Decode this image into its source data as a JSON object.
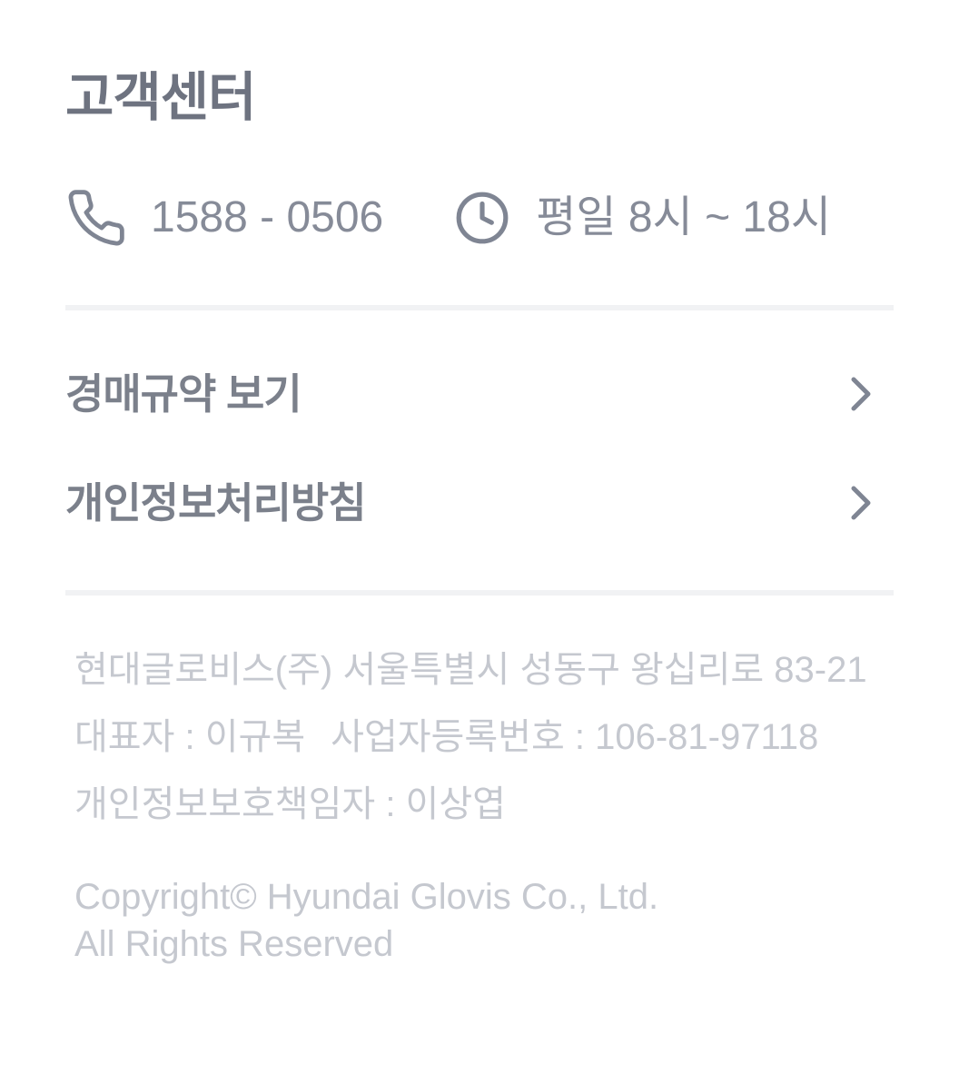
{
  "customer_center": {
    "title": "고객센터",
    "phone_icon": "phone-icon",
    "phone": "1588 - 0506",
    "clock_icon": "clock-icon",
    "hours": "평일 8시 ~ 18시"
  },
  "menu": [
    {
      "label": "경매규약 보기",
      "icon": "chevron-right-icon"
    },
    {
      "label": "개인정보처리방침",
      "icon": "chevron-right-icon"
    }
  ],
  "company": {
    "address_line": "현대글로비스(주) 서울특별시 성동구 왕십리로 83-21",
    "ceo": "대표자 : 이규복",
    "business_number": "사업자등록번호 : 106-81-97118",
    "privacy_officer": "개인정보보호책임자 : 이상엽"
  },
  "copyright": {
    "line1": "Copyright© Hyundai Glovis Co., Ltd.",
    "line2": "All Rights Reserved"
  },
  "colors": {
    "title": "#6e7380",
    "icon": "#7f8593",
    "contact_text": "#868b98",
    "menu_text": "#7b808b",
    "divider": "#f1f2f4",
    "footer_text": "#c5c8cf"
  }
}
